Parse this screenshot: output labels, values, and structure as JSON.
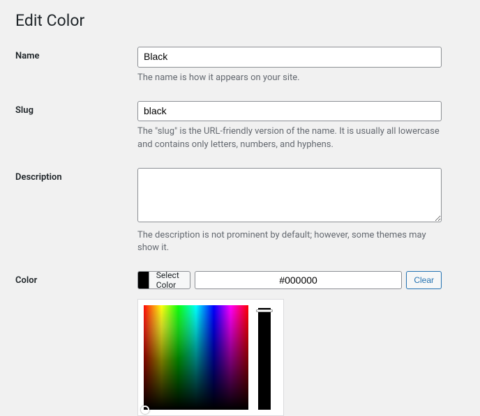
{
  "title": "Edit Color",
  "fields": {
    "name": {
      "label": "Name",
      "value": "Black",
      "help": "The name is how it appears on your site."
    },
    "slug": {
      "label": "Slug",
      "value": "black",
      "help": "The \"slug\" is the URL-friendly version of the name. It is usually all lowercase and contains only letters, numbers, and hyphens."
    },
    "description": {
      "label": "Description",
      "value": "",
      "help": "The description is not prominent by default; however, some themes may show it."
    },
    "color": {
      "label": "Color",
      "select_label": "Select Color",
      "hex": "#000000",
      "clear_label": "Clear",
      "swatch_color": "#000000"
    }
  }
}
